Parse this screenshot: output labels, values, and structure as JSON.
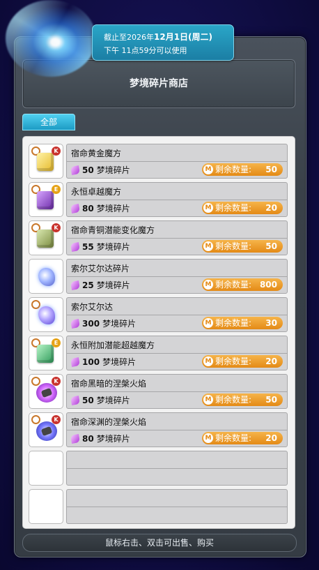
{
  "notice": {
    "line1_prefix": "截止至2026年",
    "line1_date": "12月1日(周二)",
    "line2": "下午  11点59分可以使用"
  },
  "shop": {
    "title": "梦境碎片商店"
  },
  "tabs": [
    {
      "label": "全部",
      "active": true
    }
  ],
  "items": [
    {
      "name": "宿命黄金魔方",
      "price": "50",
      "currency": "梦境碎片",
      "stock_label": "剩余数量:",
      "stock": "50",
      "icon": "golden-cube-icon",
      "badge": "K"
    },
    {
      "name": "永恒卓越魔方",
      "price": "80",
      "currency": "梦境碎片",
      "stock_label": "剩余数量:",
      "stock": "20",
      "icon": "purple-cube-icon",
      "badge": "E"
    },
    {
      "name": "宿命青铜潜能变化魔方",
      "price": "55",
      "currency": "梦境碎片",
      "stock_label": "剩余数量:",
      "stock": "50",
      "icon": "bronze-cube-icon",
      "badge": "K"
    },
    {
      "name": "索尔艾尔达碎片",
      "price": "25",
      "currency": "梦境碎片",
      "stock_label": "剩余数量:",
      "stock": "800",
      "icon": "sol-erda-fragment-icon",
      "badge": ""
    },
    {
      "name": "索尔艾尔达",
      "price": "300",
      "currency": "梦境碎片",
      "stock_label": "剩余数量:",
      "stock": "30",
      "icon": "sol-erda-icon",
      "badge": ""
    },
    {
      "name": "永恒附加潜能超越魔方",
      "price": "100",
      "currency": "梦境碎片",
      "stock_label": "剩余数量:",
      "stock": "20",
      "icon": "green-cube-icon",
      "badge": "E"
    },
    {
      "name": "宿命黑暗的涅槃火焰",
      "price": "50",
      "currency": "梦境碎片",
      "stock_label": "剩余数量:",
      "stock": "50",
      "icon": "dark-flame-icon",
      "badge": "K"
    },
    {
      "name": "宿命深渊的涅槃火焰",
      "price": "80",
      "currency": "梦境碎片",
      "stock_label": "剩余数量:",
      "stock": "20",
      "icon": "abyss-flame-icon",
      "badge": "K"
    }
  ],
  "empty_slots": 2,
  "footer": {
    "hint": "鼠标右击、双击可出售、购买"
  },
  "colors": {
    "accent": "#1d9bc4",
    "stock_pill": "#e48a16",
    "background": "#120f4a"
  }
}
